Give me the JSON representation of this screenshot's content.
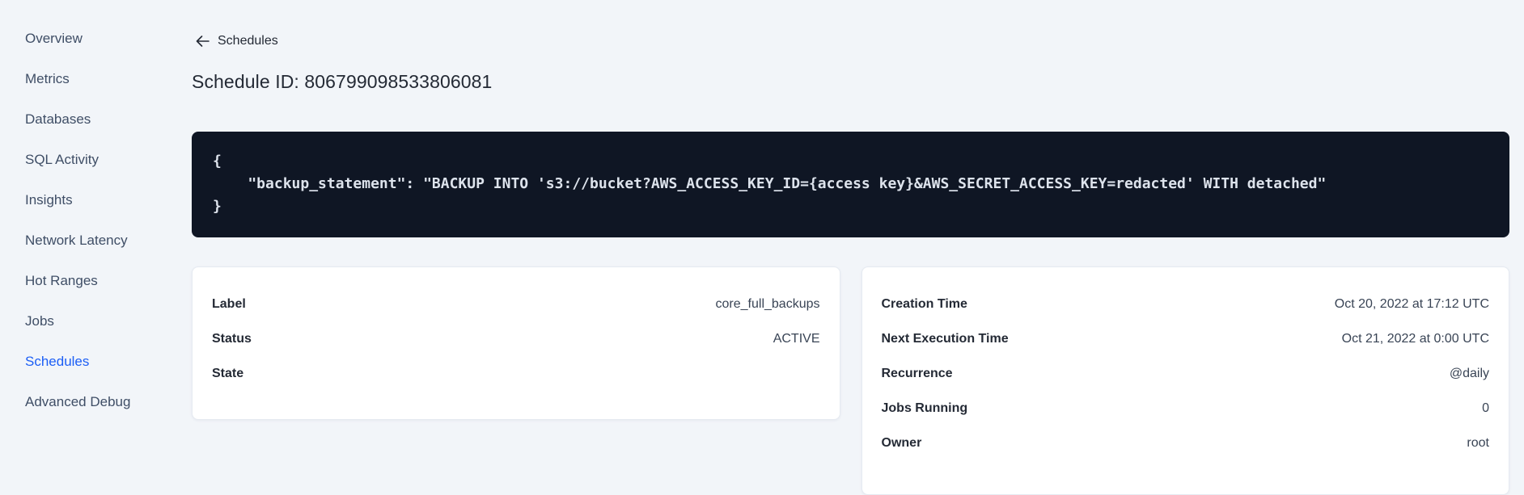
{
  "colors": {
    "page_bg": "#f2f5f9",
    "accent_blue": "#1c5ef5",
    "code_block_bg": "#0f1624",
    "code_text": "#dde3ec",
    "card_bg": "#ffffff",
    "text_primary": "#242a35",
    "text_secondary": "#394455"
  },
  "sidebar": {
    "items": [
      {
        "label": "Overview",
        "active": false
      },
      {
        "label": "Metrics",
        "active": false
      },
      {
        "label": "Databases",
        "active": false
      },
      {
        "label": "SQL Activity",
        "active": false
      },
      {
        "label": "Insights",
        "active": false
      },
      {
        "label": "Network Latency",
        "active": false
      },
      {
        "label": "Hot Ranges",
        "active": false
      },
      {
        "label": "Jobs",
        "active": false
      },
      {
        "label": "Schedules",
        "active": true
      },
      {
        "label": "Advanced Debug",
        "active": false
      }
    ]
  },
  "header": {
    "back_icon": "arrow-left",
    "back_label": "Schedules",
    "title": "Schedule ID: 806799098533806081"
  },
  "code_block": {
    "lines": [
      "{",
      "    \"backup_statement\": \"BACKUP INTO 's3://bucket?AWS_ACCESS_KEY_ID={access key}&AWS_SECRET_ACCESS_KEY=redacted' WITH detached\"",
      "}"
    ]
  },
  "details_left": {
    "rows": [
      {
        "label": "Label",
        "value": "core_full_backups"
      },
      {
        "label": "Status",
        "value": "ACTIVE"
      },
      {
        "label": "State",
        "value": ""
      }
    ]
  },
  "details_right": {
    "rows": [
      {
        "label": "Creation Time",
        "value": "Oct 20, 2022 at 17:12 UTC"
      },
      {
        "label": "Next Execution Time",
        "value": "Oct 21, 2022 at 0:00 UTC"
      },
      {
        "label": "Recurrence",
        "value": "@daily"
      },
      {
        "label": "Jobs Running",
        "value": "0"
      },
      {
        "label": "Owner",
        "value": "root"
      }
    ]
  }
}
